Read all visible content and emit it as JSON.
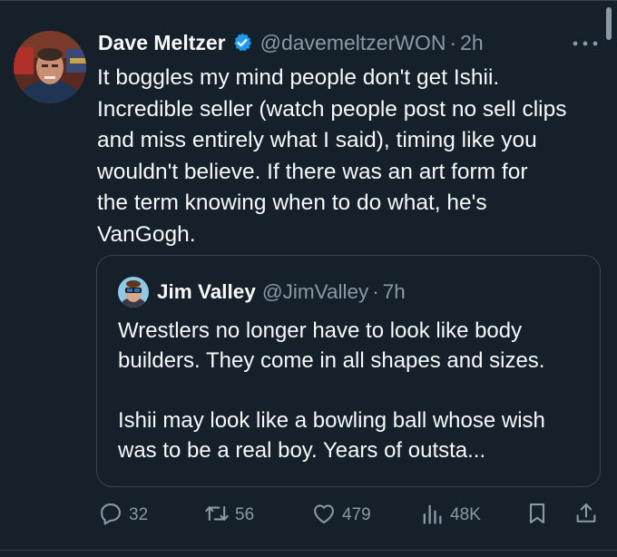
{
  "tweet": {
    "author_name": "Dave Meltzer",
    "author_handle": "@davemeltzerWON",
    "separator": "·",
    "time": "2h",
    "text": "It boggles my mind people don't get Ishii.\nIncredible seller (watch people post no sell clips\nand miss entirely what I said), timing like you\nwouldn't  believe.  If there was an art form for\nthe term knowing when to do what, he's\nVanGogh."
  },
  "quoted_tweet": {
    "author_name": "Jim Valley",
    "author_handle": "@JimValley",
    "separator": "·",
    "time": "7h",
    "paragraph_1": "Wrestlers no longer have to look like body builders. They come in all shapes and sizes.",
    "paragraph_2": "Ishii may look like a bowling ball whose wish was to be a real boy. Years of outsta..."
  },
  "actions": {
    "replies": "32",
    "reposts": "56",
    "likes": "479",
    "views": "48K"
  },
  "icons": {
    "verified": "verified-badge-icon",
    "more": "more-options-icon",
    "reply": "reply-icon",
    "repost": "repost-icon",
    "like": "like-icon",
    "views": "views-icon",
    "bookmark": "bookmark-icon",
    "share": "share-icon"
  },
  "colors": {
    "background": "#15202b",
    "text_primary": "#f7f9f9",
    "text_secondary": "#8b98a5",
    "accent": "#1d9bf0",
    "border": "#38444d"
  }
}
